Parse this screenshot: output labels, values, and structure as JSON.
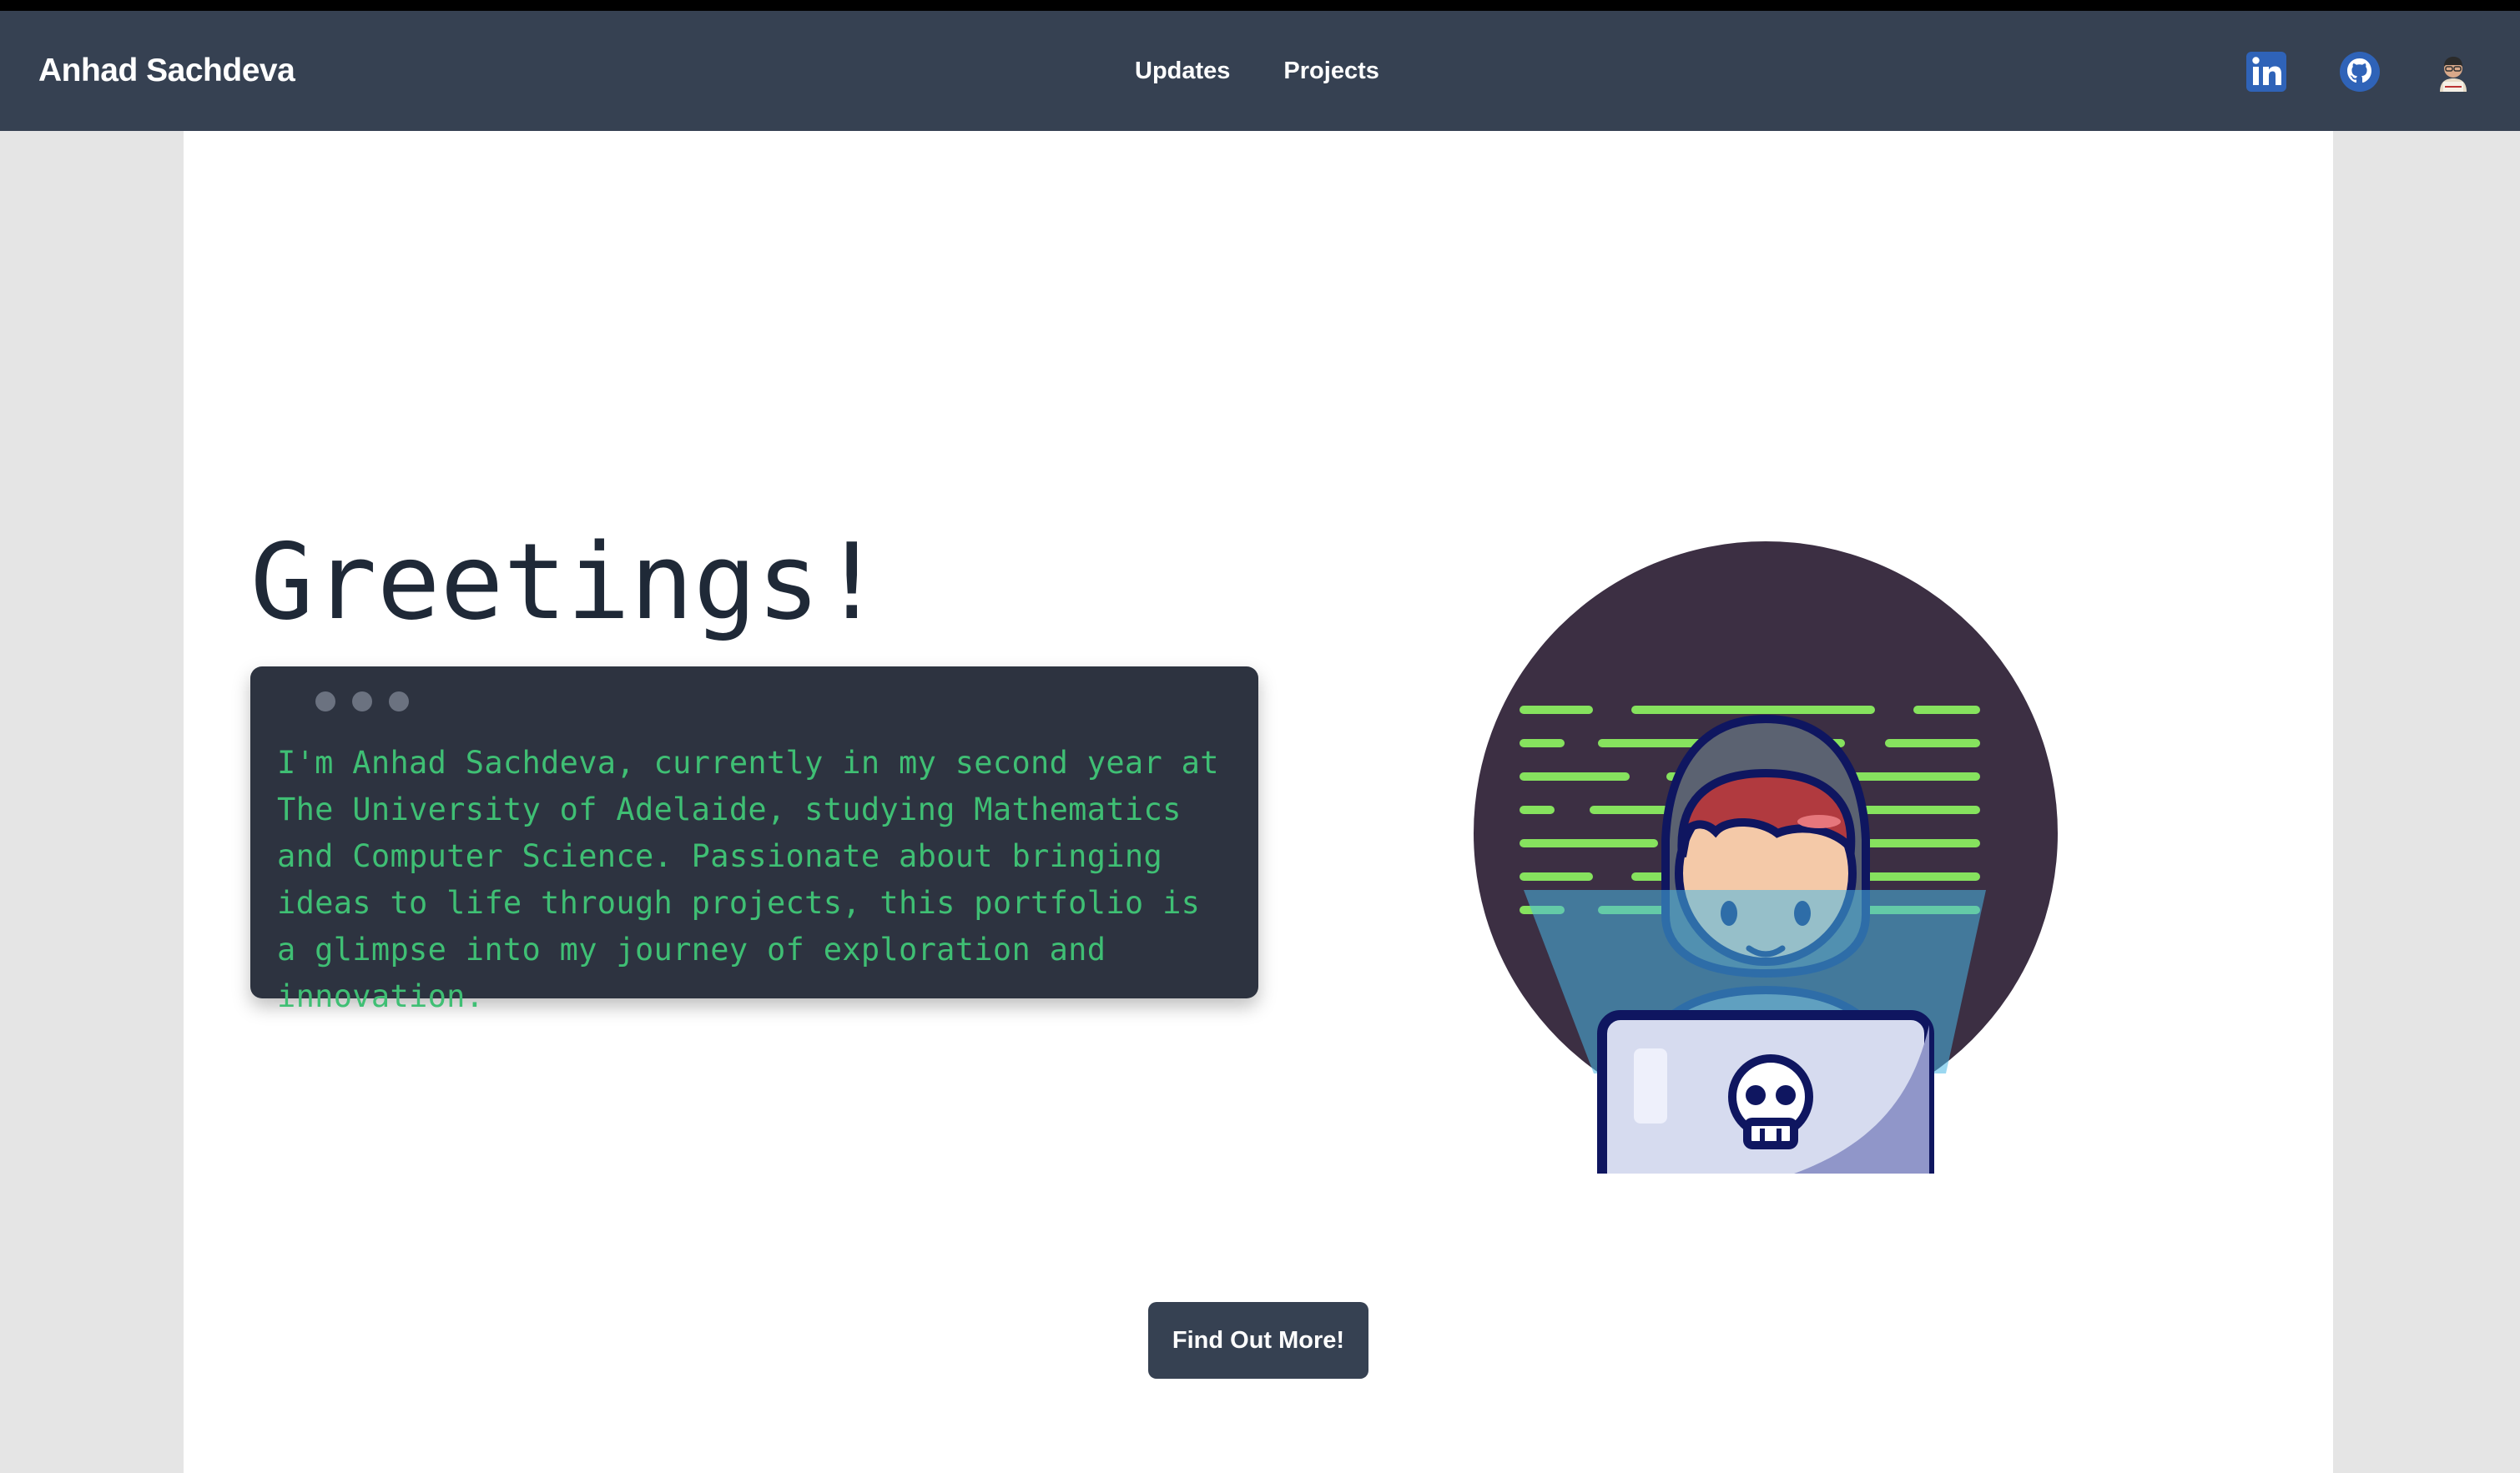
{
  "navbar": {
    "brand": "Anhad Sachdeva",
    "links": [
      "Updates",
      "Projects"
    ],
    "icons": [
      "linkedin-icon",
      "github-icon",
      "avatar"
    ]
  },
  "hero": {
    "title": "Greetings!",
    "bio": "I'm Anhad Sachdeva, currently in my second year at The University of Adelaide, studying Mathematics and Computer Science. Passionate about bringing ideas to life through projects, this portfolio is a glimpse into my journey of exploration and innovation.",
    "illustration": "hacker-laptop-illustration"
  },
  "cta": {
    "label": "Find Out More!"
  },
  "colors": {
    "navbar": "#364152",
    "terminal_bg": "#2d3340",
    "terminal_text": "#3fbf74",
    "page_bg": "#e5e5e5"
  }
}
